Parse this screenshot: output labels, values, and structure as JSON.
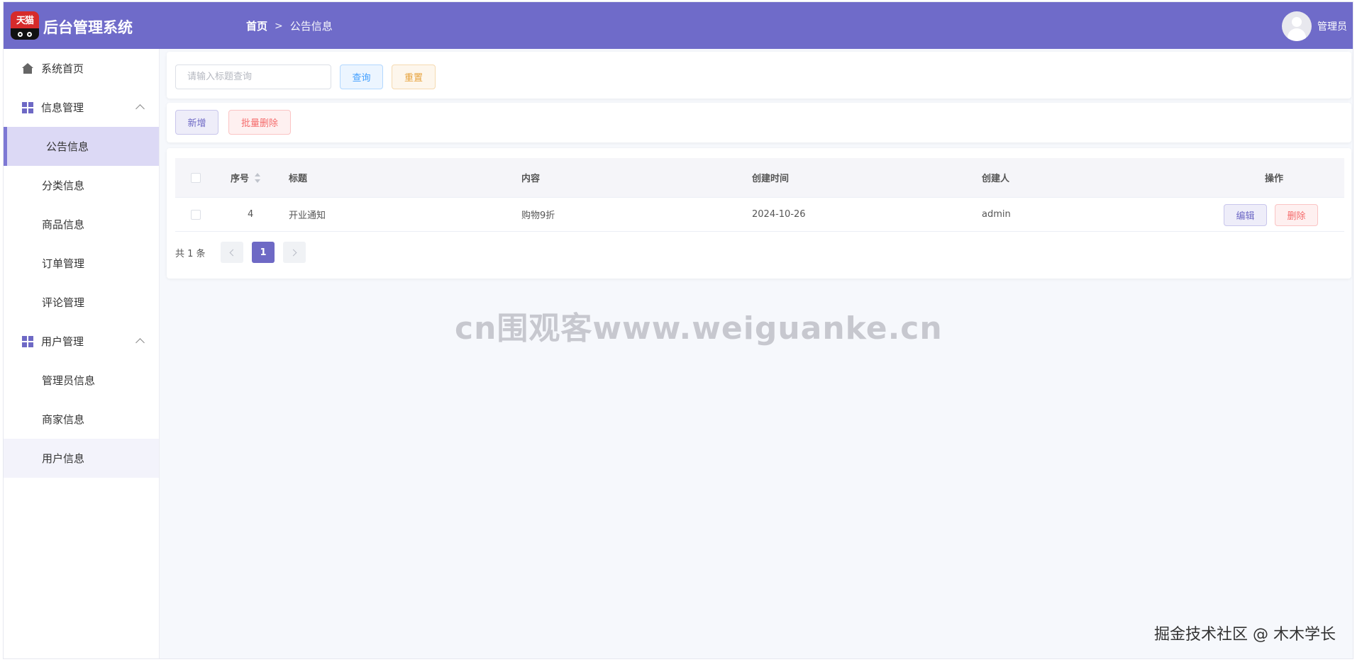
{
  "header": {
    "logo_text": "天猫",
    "app_title": "后台管理系统",
    "breadcrumb": {
      "home": "首页",
      "separator": ">",
      "current": "公告信息"
    },
    "user_name": "管理员"
  },
  "sidebar": {
    "home": "系统首页",
    "groups": [
      {
        "label": "信息管理",
        "items": [
          "公告信息",
          "分类信息",
          "商品信息",
          "订单管理",
          "评论管理"
        ]
      },
      {
        "label": "用户管理",
        "items": [
          "管理员信息",
          "商家信息",
          "用户信息"
        ]
      }
    ],
    "active_item": "公告信息"
  },
  "search": {
    "placeholder": "请输入标题查询",
    "query_label": "查询",
    "reset_label": "重置"
  },
  "toolbar": {
    "add_label": "新增",
    "batch_delete_label": "批量删除"
  },
  "table": {
    "columns": [
      "序号",
      "标题",
      "内容",
      "创建时间",
      "创建人",
      "操作"
    ],
    "rows": [
      {
        "id": "4",
        "title": "开业通知",
        "content": "购物9折",
        "created_at": "2024-10-26",
        "creator": "admin"
      }
    ],
    "edit_label": "编辑",
    "delete_label": "删除"
  },
  "pagination": {
    "total_text": "共 1 条",
    "current_page": "1"
  },
  "overlay": {
    "watermark": "cn围观客www.weiguanke.cn",
    "credit": "掘金技术社区 @ 木木学长"
  },
  "colors": {
    "primary": "#6f6bc9",
    "active_bg": "#dcd9f5",
    "query": "#409eff",
    "reset": "#e6a23c",
    "danger": "#f56c6c"
  }
}
